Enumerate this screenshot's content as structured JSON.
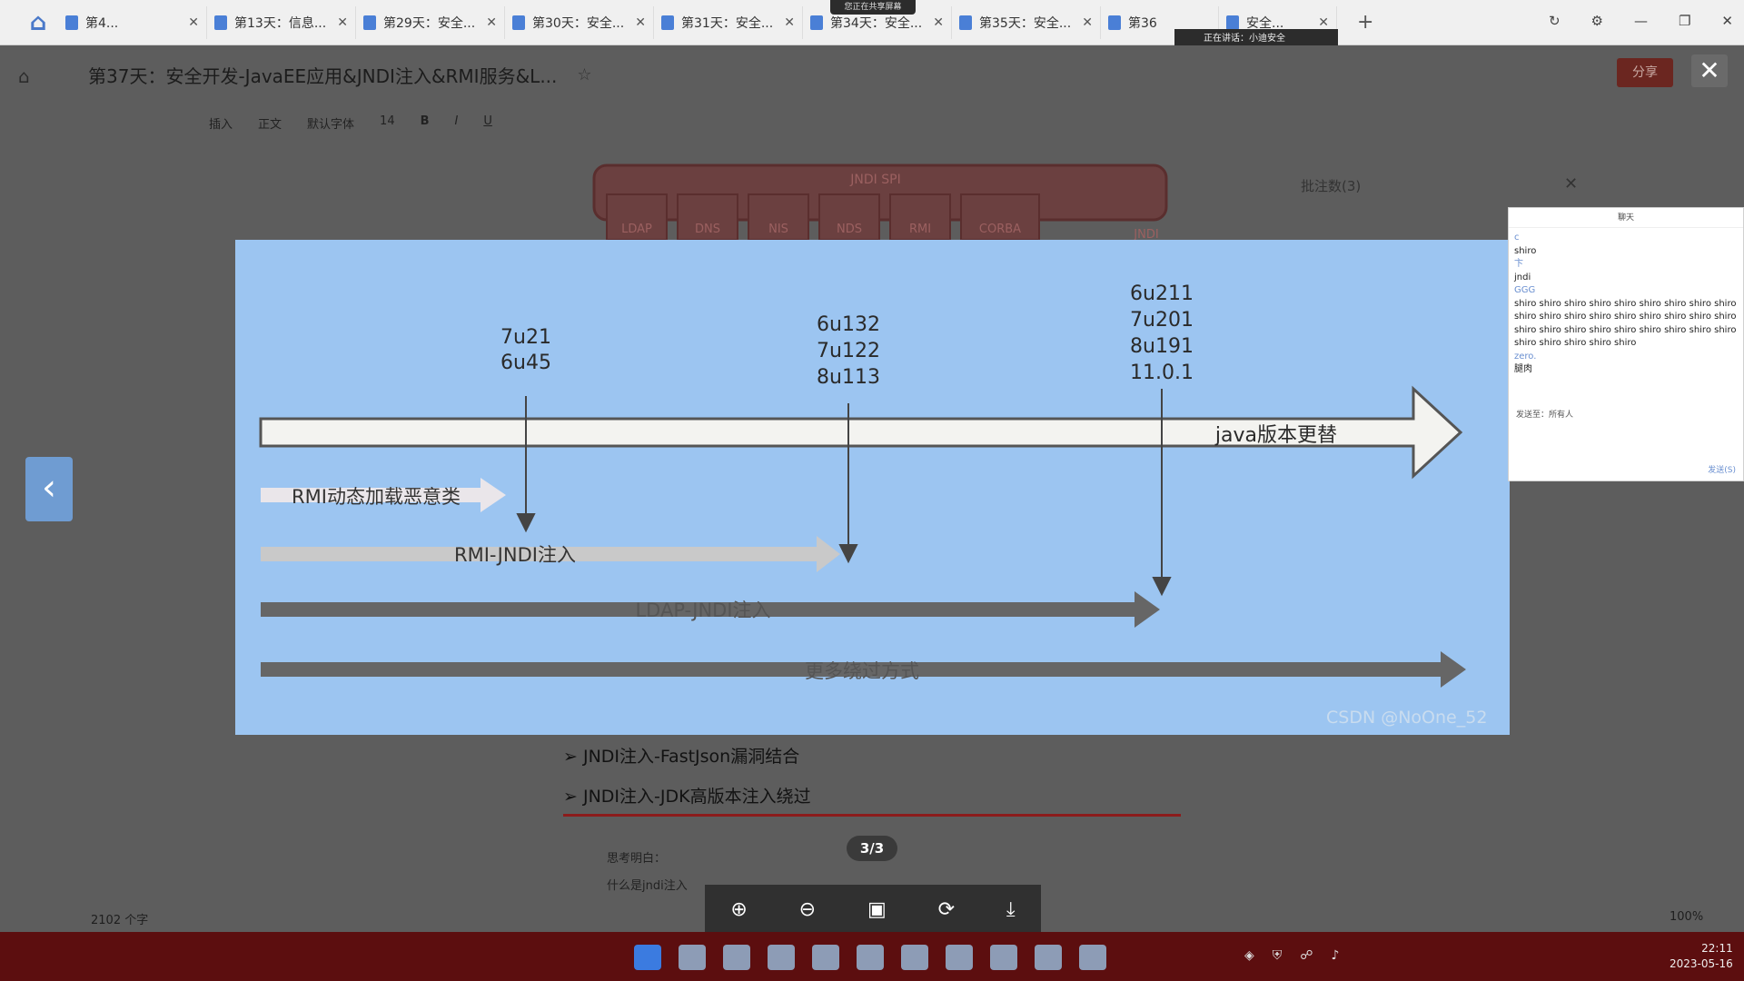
{
  "tabs": [
    {
      "label": "第4..."
    },
    {
      "label": "第13天：信息..."
    },
    {
      "label": "第29天：安全..."
    },
    {
      "label": "第30天：安全..."
    },
    {
      "label": "第31天：安全..."
    },
    {
      "label": "第34天：安全..."
    },
    {
      "label": "第35天：安全..."
    },
    {
      "label": "第36"
    },
    {
      "label": "安全..."
    }
  ],
  "share_banner": "您正在共享屏幕",
  "speaking_label": "正在讲话：小迪安全",
  "doc": {
    "title": "第37天：安全开发-JavaEE应用&JNDI注入&RMI服务&L...",
    "share_button": "分享",
    "comments_header": "批注数(3)",
    "toolbar": [
      "插入",
      "正文",
      "默认字体",
      "14"
    ]
  },
  "slide": {
    "background_color": "#9cc5f1",
    "versions_a": [
      "7u21",
      "6u45"
    ],
    "versions_b": [
      "6u132",
      "7u122",
      "8u113"
    ],
    "versions_c": [
      "6u211",
      "7u201",
      "8u191",
      "11.0.1"
    ],
    "timeline_label": "java版本更替",
    "arrow_1": "RMI动态加载恶意类",
    "arrow_2": "RMI-JNDI注入",
    "arrow_3": "LDAP-JNDI注入",
    "arrow_4": "更多绕过方式",
    "watermark": "CSDN @NoOne_52",
    "jndi_box_label": "JNDI SPI",
    "jndi_boxes": [
      "LDAP",
      "DNS",
      "NIS",
      "NDS",
      "RMI",
      "CORBA"
    ],
    "jndi_corner": "JNDI"
  },
  "below": {
    "bullet_1": "JNDI注入-FastJson漏洞结合",
    "bullet_2": "JNDI注入-JDK高版本注入绕过",
    "note_1": "思考明白：",
    "note_2": "什么是jndi注入"
  },
  "viewer": {
    "page_indicator": "3/3"
  },
  "status": {
    "word_count": "2102 个字",
    "zoom": "100%"
  },
  "chat": {
    "title": "聊天",
    "lines": [
      {
        "text": "c",
        "meta": true
      },
      {
        "text": "shiro",
        "meta": false
      },
      {
        "text": "卞",
        "meta": true
      },
      {
        "text": "jndi",
        "meta": false
      },
      {
        "text": "GGG",
        "meta": true
      },
      {
        "text": "shiro shiro shiro shiro shiro shiro shiro shiro shiro shiro shiro shiro shiro shiro shiro shiro shiro shiro shiro shiro shiro shiro shiro shiro shiro shiro shiro shiro shiro shiro shiro shiro",
        "meta": false
      },
      {
        "text": "zero.",
        "meta": true
      },
      {
        "text": "腿肉",
        "meta": false
      }
    ],
    "send_to": "发送至：所有人",
    "send_button": "发送(S)"
  },
  "clock": {
    "time": "22:11",
    "date": "2023-05-16"
  }
}
